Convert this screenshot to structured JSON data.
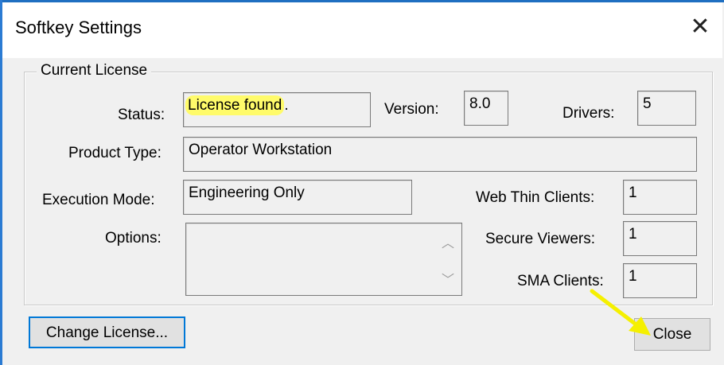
{
  "window": {
    "title": "Softkey Settings"
  },
  "group": {
    "title": "Current License"
  },
  "status": {
    "label": "Status:",
    "value": "License found",
    "suffix": "."
  },
  "version": {
    "label": "Version:",
    "value": "8.0"
  },
  "drivers": {
    "label": "Drivers:",
    "value": "5"
  },
  "product_type": {
    "label": "Product Type:",
    "value": "Operator Workstation"
  },
  "execution_mode": {
    "label": "Execution Mode:",
    "value": "Engineering Only"
  },
  "options": {
    "label": "Options:",
    "value": ""
  },
  "web_thin_clients": {
    "label": "Web Thin Clients:",
    "value": "1"
  },
  "secure_viewers": {
    "label": "Secure Viewers:",
    "value": "1"
  },
  "sma_clients": {
    "label": "SMA Clients:",
    "value": "1"
  },
  "buttons": {
    "change_license": "Change License...",
    "close": "Close"
  },
  "colors": {
    "highlight": "#fffb6a",
    "arrow": "#f5f000",
    "focus_border": "#0078d7"
  },
  "icons": {
    "close": "close-icon",
    "scroll_up": "scroll-up-icon",
    "scroll_down": "scroll-down-icon",
    "annotation": "arrow-annotation"
  }
}
